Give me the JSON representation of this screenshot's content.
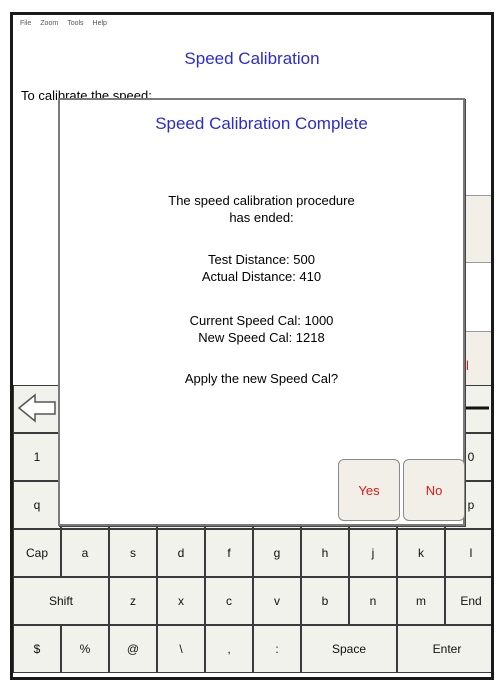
{
  "menu": [
    "File",
    "Zoom",
    "Tools",
    "Help"
  ],
  "app_title": "Speed Calibration",
  "instruction": "To calibrate the speed:",
  "side_buttons": {
    "prev": "rev",
    "cancel": "ncel"
  },
  "dialog": {
    "title": "Speed Calibration Complete",
    "message_line1": "The speed calibration procedure",
    "message_line2": "has ended:",
    "test_distance": "Test Distance:  500",
    "actual_distance": "Actual Distance: 410",
    "current_speed_cal": "Current Speed Cal: 1000",
    "new_speed_cal": "New Speed Cal:  1218",
    "question": "Apply the new Speed Cal?",
    "yes_label": "Yes",
    "no_label": "No"
  },
  "keyboard": {
    "row1_keys": [
      "",
      "",
      "",
      "",
      "",
      "",
      "",
      "",
      "",
      ""
    ],
    "row2_keys": [
      "1",
      "",
      "",
      "",
      "",
      "",
      "",
      "",
      "",
      "0"
    ],
    "row3_keys": [
      "q",
      "",
      "",
      "",
      "",
      "",
      "",
      "",
      "",
      "p"
    ],
    "row4_keys": [
      "Cap",
      "a",
      "s",
      "d",
      "f",
      "g",
      "h",
      "j",
      "k",
      "l"
    ],
    "row5_keys": [
      "Shift",
      "z",
      "x",
      "c",
      "v",
      "b",
      "n",
      "m",
      "End"
    ],
    "row6_keys": [
      "$",
      "%",
      "@",
      "\\",
      ",",
      ":",
      "Space",
      "Enter"
    ]
  }
}
